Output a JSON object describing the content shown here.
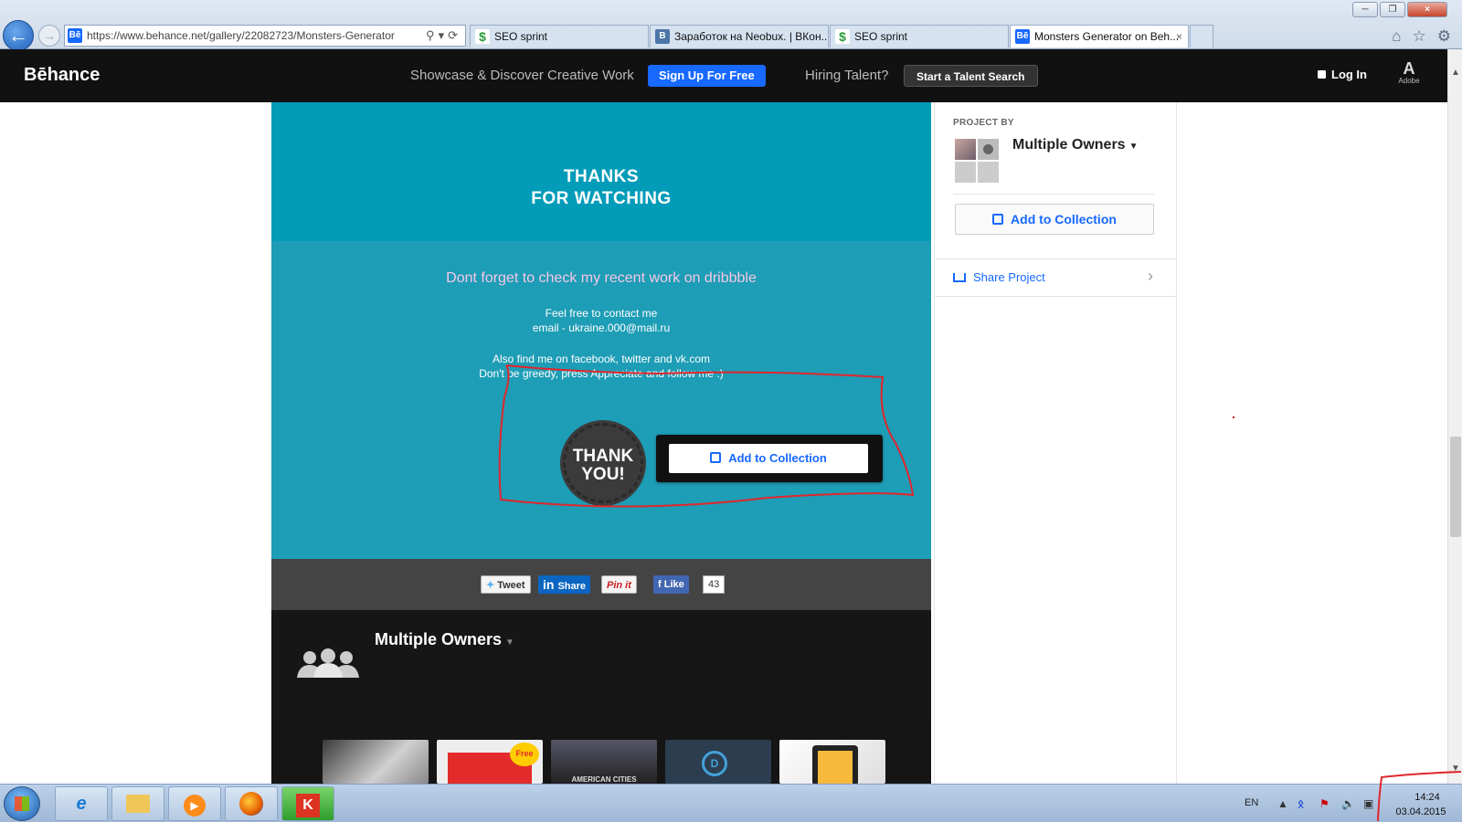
{
  "browser": {
    "address_url": "https://www.behance.net/gallery/22082723/Monsters-Generator",
    "tabs": [
      {
        "label": "SEO sprint",
        "icon": "seosprint-favicon"
      },
      {
        "label": "Заработок на Neobux. | ВКон...",
        "icon": "vk-favicon"
      },
      {
        "label": "SEO sprint",
        "icon": "seosprint-favicon"
      },
      {
        "label": "Monsters Generator on Beh...",
        "icon": "behance-favicon",
        "active": true
      }
    ]
  },
  "behance_header": {
    "logo": "Bēhance",
    "tagline": "Showcase & Discover Creative Work",
    "signup_label": "Sign Up For Free",
    "hiring_text": "Hiring Talent?",
    "talent_label": "Start a Talent Search",
    "login_label": "Log In",
    "adobe_label": "Adobe"
  },
  "project": {
    "thanks_line1": "THANKS",
    "thanks_line2": "FOR WATCHING",
    "dribbble_text": "Dont forget to check my recent work on dribbble",
    "contact_line1": "Feel free to contact me",
    "contact_line2": "email - ukraine.000@mail.ru",
    "social_line1": "Also find me on facebook, twitter and vk.com",
    "social_line2": "Don't be greedy, press Appreciate and follow me :)",
    "badge_line1": "THANK",
    "badge_line2": "YOU!",
    "add_to_collection": "Add to Collection"
  },
  "share_bar": {
    "tweet": "Tweet",
    "linkedin": "Share",
    "pinterest": "Pin it",
    "facebook": "Like",
    "facebook_count": "43"
  },
  "owners_section": {
    "title": "Multiple Owners",
    "thumb2_badge": "Free",
    "thumb3_caption": "AMERICAN CITIES",
    "thumb4_logo": "D"
  },
  "sidebar": {
    "project_by": "PROJECT BY",
    "owner_name": "Multiple Owners",
    "add_to_collection": "Add to Collection",
    "share_project": "Share Project"
  },
  "taskbar": {
    "language": "EN",
    "time": "14:24",
    "date": "03.04.2015"
  },
  "colors": {
    "teal_top": "#029cb9",
    "teal_bottom": "#1e9db6",
    "behance_blue": "#1769ff",
    "annotation_red": "#e0262c"
  }
}
